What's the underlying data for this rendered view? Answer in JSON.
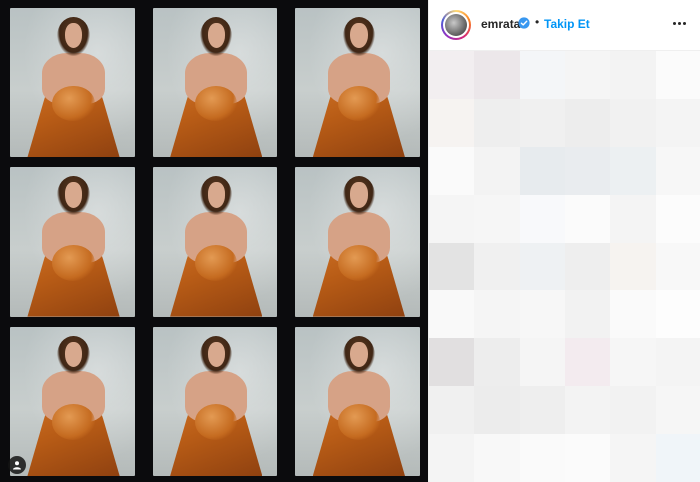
{
  "post": {
    "username": "emrata",
    "separator": "•",
    "follow_label": "Takip Et"
  },
  "icons": {
    "verified": "verified-badge-icon",
    "more": "more-options-icon",
    "user_tag": "user-tag-icon"
  },
  "colors": {
    "follow_blue": "#0095f6",
    "verified_blue": "#3897f0",
    "dress_orange": "#c56b20"
  },
  "photo": {
    "frames": 9
  },
  "comments": {
    "blurred": true
  }
}
